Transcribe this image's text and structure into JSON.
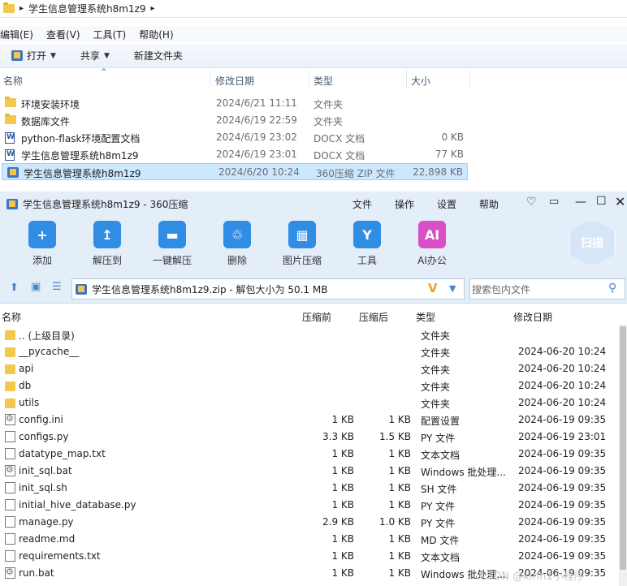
{
  "explorer": {
    "path": "学生信息管理系统h8m1z9",
    "path_arrow": "▸",
    "menu": [
      "编辑(E)",
      "查看(V)",
      "工具(T)",
      "帮助(H)"
    ],
    "toolbar": {
      "open": "打开",
      "share": "共享",
      "new_folder": "新建文件夹"
    },
    "columns": {
      "name": "名称",
      "modified": "修改日期",
      "type": "类型",
      "size": "大小"
    },
    "files": [
      {
        "name": "环境安装环境",
        "date": "2024/6/21 11:11",
        "type": "文件夹",
        "size": "",
        "icon": "folder-icon"
      },
      {
        "name": "数据库文件",
        "date": "2024/6/19 22:59",
        "type": "文件夹",
        "size": "",
        "icon": "folder-icon"
      },
      {
        "name": "python-flask环境配置文档",
        "date": "2024/6/19 23:02",
        "type": "DOCX 文档",
        "size": "0 KB",
        "icon": "docx-icon"
      },
      {
        "name": "学生信息管理系统h8m1z9",
        "date": "2024/6/19 23:01",
        "type": "DOCX 文档",
        "size": "77 KB",
        "icon": "docx-icon"
      },
      {
        "name": "学生信息管理系统h8m1z9",
        "date": "2024/6/20 10:24",
        "type": "360压缩 ZIP 文件",
        "size": "22,898 KB",
        "icon": "zip-icon"
      }
    ]
  },
  "zip_window": {
    "title": "学生信息管理系统h8m1z9 - 360压缩",
    "menu": [
      "文件",
      "操作",
      "设置",
      "帮助"
    ],
    "toolbar": [
      {
        "label": "添加",
        "icon": "add-icon",
        "color": "#2f8de4"
      },
      {
        "label": "解压到",
        "icon": "extract-to-icon",
        "color": "#2f8de4"
      },
      {
        "label": "一键解压",
        "icon": "one-click-extract-icon",
        "color": "#2f8de4"
      },
      {
        "label": "删除",
        "icon": "delete-icon",
        "color": "#2f8de4"
      },
      {
        "label": "图片压缩",
        "icon": "image-compress-icon",
        "color": "#2f8de4"
      },
      {
        "label": "工具",
        "icon": "tools-icon",
        "color": "#2f8de4"
      },
      {
        "label": "AI办公",
        "icon": "ai-office-icon",
        "color": "#d84fc8"
      }
    ],
    "scan_label": "扫描",
    "path_text": "学生信息管理系统h8m1z9.zip - 解包大小为 50.1 MB",
    "search_placeholder": "搜索包内文件",
    "columns": {
      "name": "名称",
      "compressed": "压缩前",
      "after": "压缩后",
      "type": "类型",
      "modified": "修改日期"
    },
    "files": [
      {
        "name": ".. (上级目录)",
        "before": "",
        "after": "",
        "type": "文件夹",
        "date": "",
        "icon": "dir"
      },
      {
        "name": "__pycache__",
        "before": "",
        "after": "",
        "type": "文件夹",
        "date": "2024-06-20 10:24",
        "icon": "dir"
      },
      {
        "name": "api",
        "before": "",
        "after": "",
        "type": "文件夹",
        "date": "2024-06-20 10:24",
        "icon": "dir"
      },
      {
        "name": "db",
        "before": "",
        "after": "",
        "type": "文件夹",
        "date": "2024-06-20 10:24",
        "icon": "dir"
      },
      {
        "name": "utils",
        "before": "",
        "after": "",
        "type": "文件夹",
        "date": "2024-06-20 10:24",
        "icon": "dir"
      },
      {
        "name": "config.ini",
        "before": "1 KB",
        "after": "1 KB",
        "type": "配置设置",
        "date": "2024-06-19 09:35",
        "icon": "gear"
      },
      {
        "name": "configs.py",
        "before": "3.3 KB",
        "after": "1.5 KB",
        "type": "PY 文件",
        "date": "2024-06-19 23:01",
        "icon": "file"
      },
      {
        "name": "datatype_map.txt",
        "before": "1 KB",
        "after": "1 KB",
        "type": "文本文档",
        "date": "2024-06-19 09:35",
        "icon": "file"
      },
      {
        "name": "init_sql.bat",
        "before": "1 KB",
        "after": "1 KB",
        "type": "Windows 批处理...",
        "date": "2024-06-19 09:35",
        "icon": "gear"
      },
      {
        "name": "init_sql.sh",
        "before": "1 KB",
        "after": "1 KB",
        "type": "SH 文件",
        "date": "2024-06-19 09:35",
        "icon": "file"
      },
      {
        "name": "initial_hive_database.py",
        "before": "1 KB",
        "after": "1 KB",
        "type": "PY 文件",
        "date": "2024-06-19 09:35",
        "icon": "file"
      },
      {
        "name": "manage.py",
        "before": "2.9 KB",
        "after": "1.0 KB",
        "type": "PY 文件",
        "date": "2024-06-19 09:35",
        "icon": "file"
      },
      {
        "name": "readme.md",
        "before": "1 KB",
        "after": "1 KB",
        "type": "MD 文件",
        "date": "2024-06-19 09:35",
        "icon": "file"
      },
      {
        "name": "requirements.txt",
        "before": "1 KB",
        "after": "1 KB",
        "type": "文本文档",
        "date": "2024-06-19 09:35",
        "icon": "file"
      },
      {
        "name": "run.bat",
        "before": "1 KB",
        "after": "1 KB",
        "type": "Windows 批处理...",
        "date": "2024-06-19 09:35",
        "icon": "gear"
      }
    ]
  },
  "watermark": "CSDN @kirin1小程序"
}
